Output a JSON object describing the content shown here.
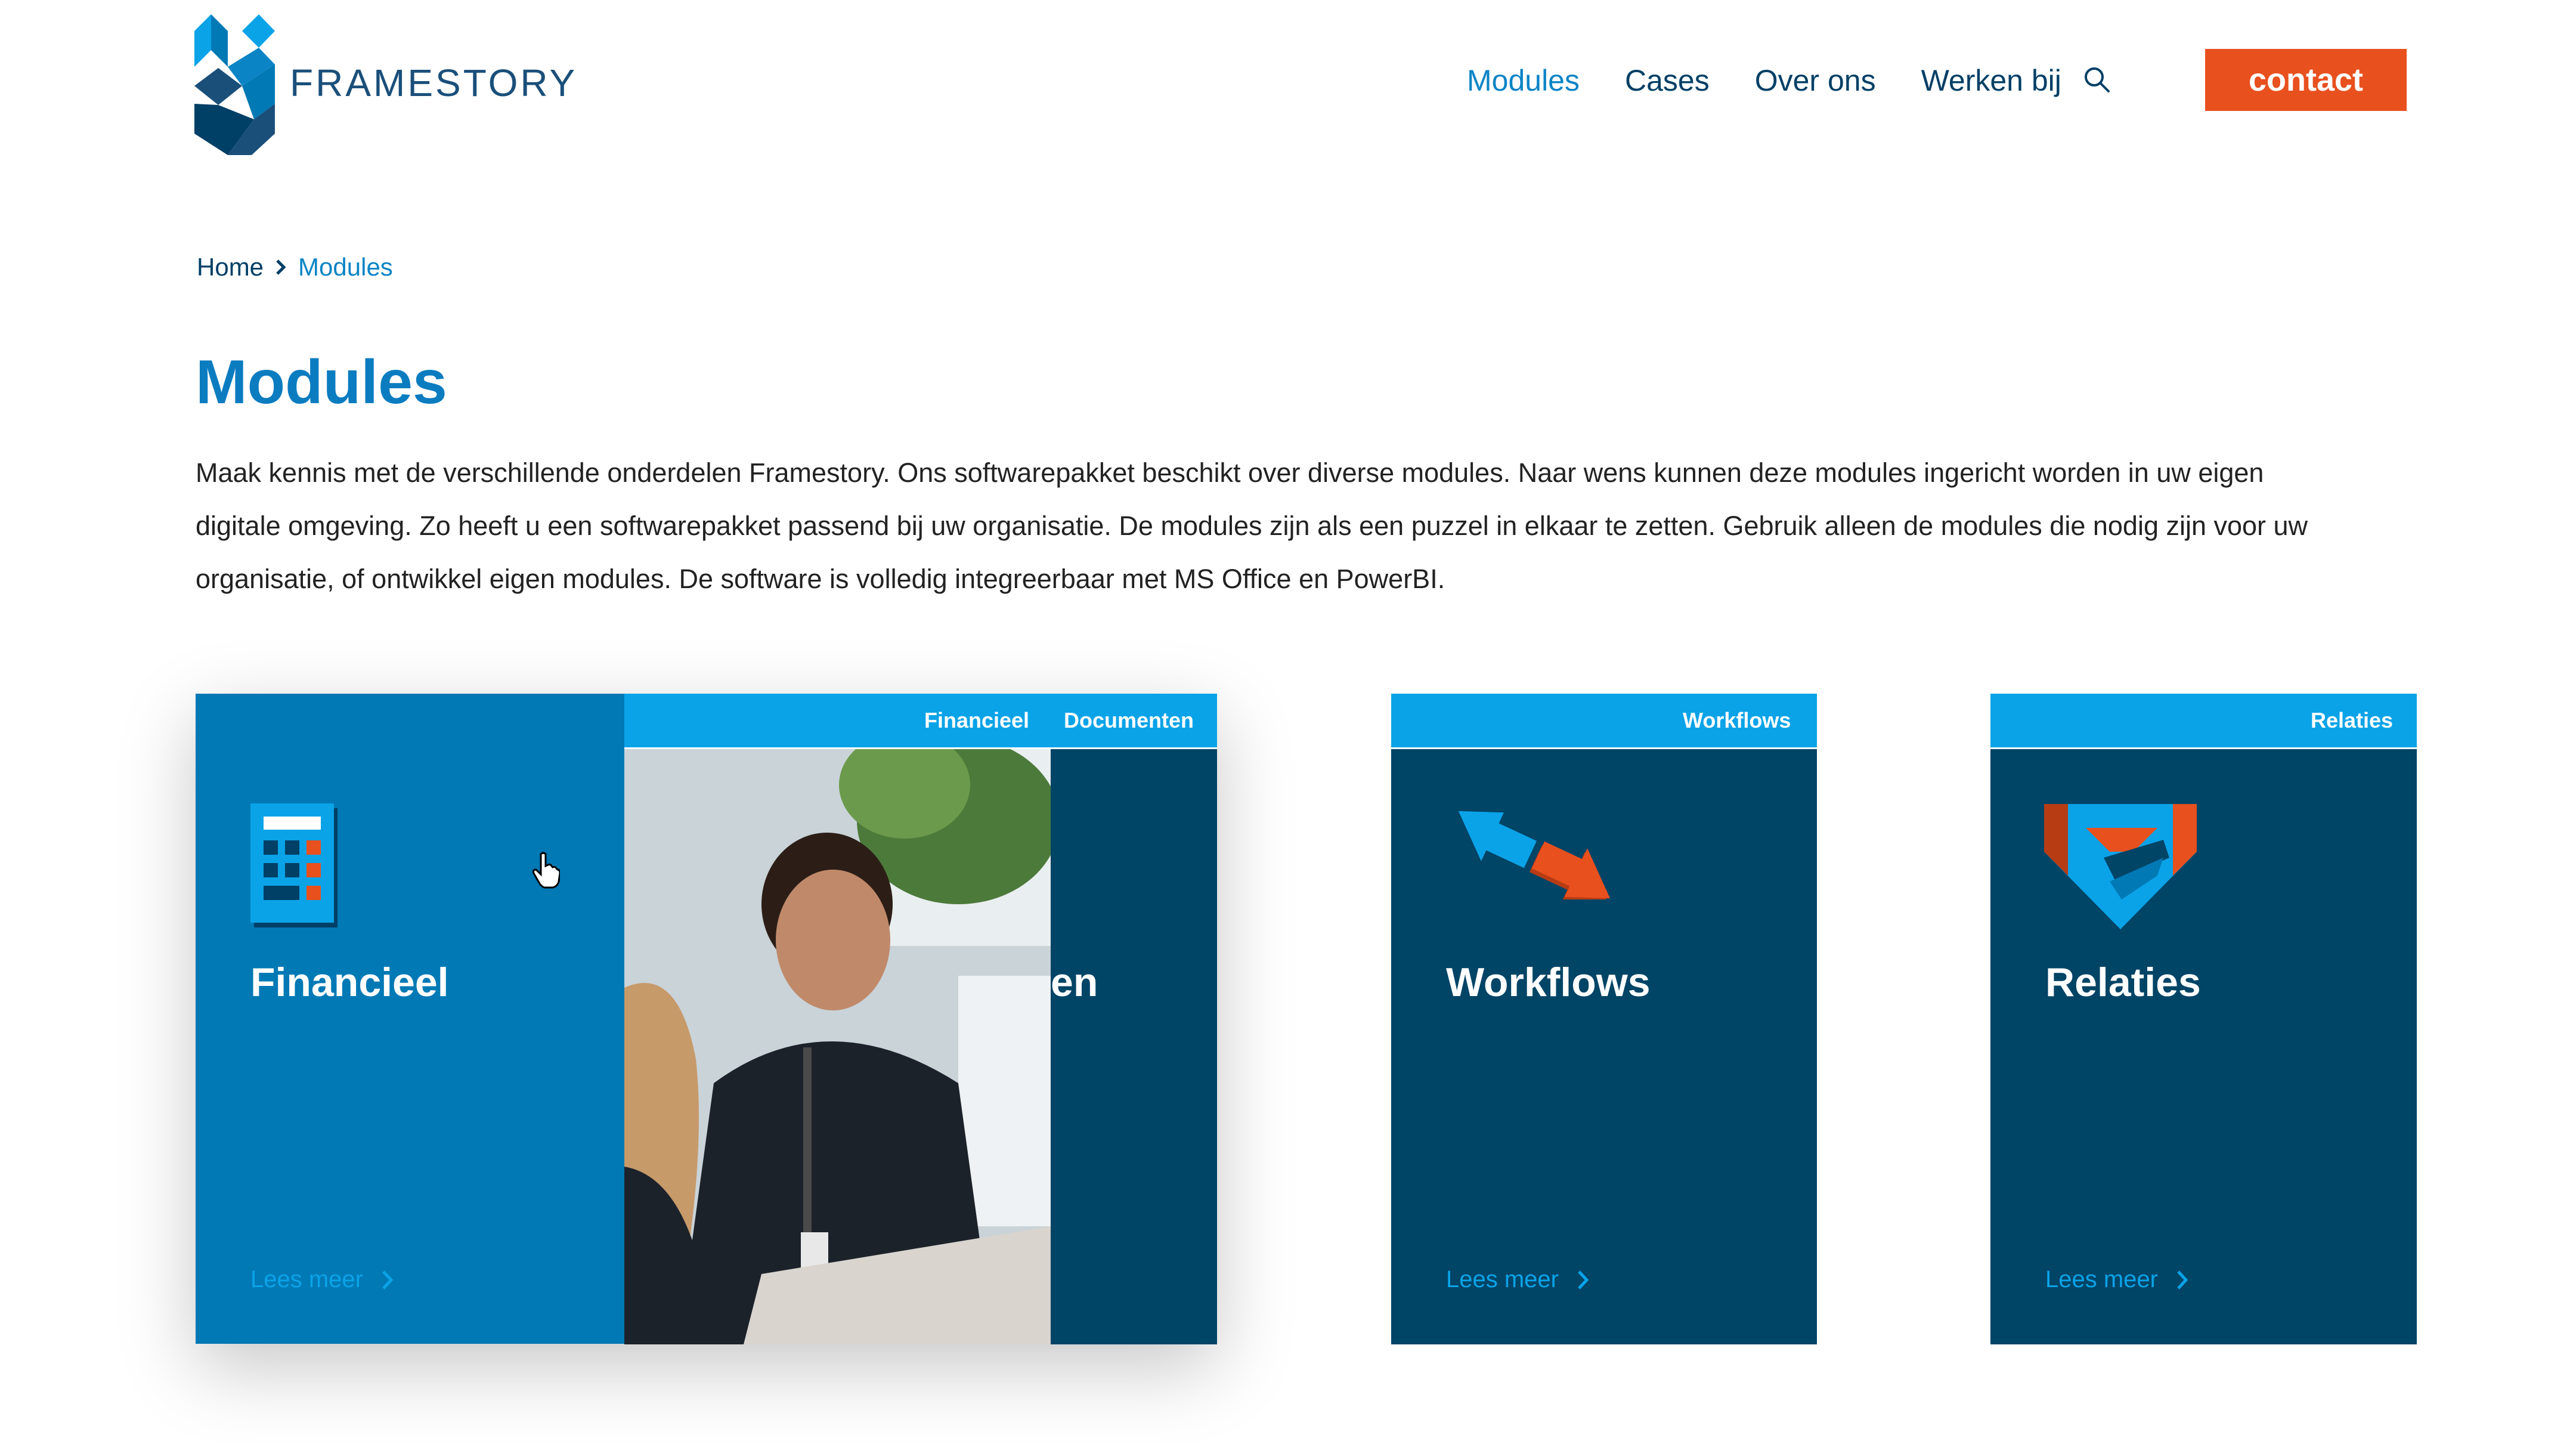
{
  "brand": {
    "name": "FRAMESTORY"
  },
  "nav": {
    "items": [
      {
        "label": "Modules",
        "active": true
      },
      {
        "label": "Cases",
        "active": false
      },
      {
        "label": "Over ons",
        "active": false
      },
      {
        "label": "Werken bij",
        "active": false
      }
    ],
    "search_icon": "search-icon",
    "contact_label": "contact"
  },
  "breadcrumb": {
    "home": "Home",
    "current": "Modules"
  },
  "page": {
    "title": "Modules",
    "intro_lines": [
      "Maak kennis met de verschillende onderdelen Framestory. Ons softwarepakket beschikt over diverse modules. Naar wens kunnen deze modules ingericht worden in uw eigen",
      "digitale omgeving. Zo heeft u een softwarepakket passend bij uw organisatie. De modules zijn als een puzzel in elkaar te zetten. Gebruik alleen de modules die nodig zijn voor uw",
      "organisatie, of ontwikkel eigen modules. De software is volledig integreerbaar met MS Office en PowerBI."
    ]
  },
  "cards": {
    "financieel": {
      "tag": "Financieel",
      "title": "Financieel",
      "link": "Lees meer",
      "icon": "calculator-icon"
    },
    "documenten": {
      "tag": "Documenten",
      "title_partial": "en"
    },
    "workflows": {
      "tag": "Workflows",
      "title": "Workflows",
      "link": "Lees meer",
      "icon": "arrows-exchange-icon"
    },
    "relaties": {
      "tag": "Relaties",
      "title": "Relaties",
      "link": "Lees meer",
      "icon": "handshake-icon"
    }
  },
  "colors": {
    "dark_blue": "#004466",
    "mid_blue": "#0079b5",
    "light_blue": "#0aa3e8",
    "accent_orange": "#e8501e",
    "title_blue": "#0b7cc0"
  }
}
